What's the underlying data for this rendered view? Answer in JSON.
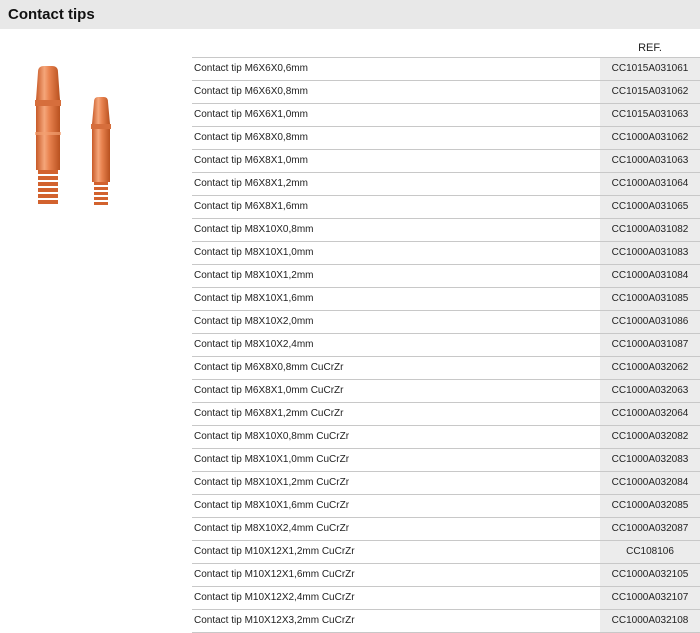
{
  "header": {
    "title": "Contact tips"
  },
  "table": {
    "ref_header": "REF.",
    "rows": [
      {
        "description": "Contact tip M6X6X0,6mm",
        "ref": "CC1015A031061"
      },
      {
        "description": "Contact tip M6X6X0,8mm",
        "ref": "CC1015A031062"
      },
      {
        "description": "Contact tip M6X6X1,0mm",
        "ref": "CC1015A031063"
      },
      {
        "description": "Contact tip M6X8X0,8mm",
        "ref": "CC1000A031062"
      },
      {
        "description": "Contact tip M6X8X1,0mm",
        "ref": "CC1000A031063"
      },
      {
        "description": "Contact tip M6X8X1,2mm",
        "ref": "CC1000A031064"
      },
      {
        "description": "Contact tip M6X8X1,6mm",
        "ref": "CC1000A031065"
      },
      {
        "description": "Contact tip M8X10X0,8mm",
        "ref": "CC1000A031082"
      },
      {
        "description": "Contact tip M8X10X1,0mm",
        "ref": "CC1000A031083"
      },
      {
        "description": "Contact tip M8X10X1,2mm",
        "ref": "CC1000A031084"
      },
      {
        "description": "Contact tip M8X10X1,6mm",
        "ref": "CC1000A031085"
      },
      {
        "description": "Contact tip M8X10X2,0mm",
        "ref": "CC1000A031086"
      },
      {
        "description": "Contact tip M8X10X2,4mm",
        "ref": "CC1000A031087"
      },
      {
        "description": "Contact tip M6X8X0,8mm CuCrZr",
        "ref": "CC1000A032062"
      },
      {
        "description": "Contact tip M6X8X1,0mm CuCrZr",
        "ref": "CC1000A032063"
      },
      {
        "description": "Contact tip M6X8X1,2mm CuCrZr",
        "ref": "CC1000A032064"
      },
      {
        "description": "Contact tip M8X10X0,8mm CuCrZr",
        "ref": "CC1000A032082"
      },
      {
        "description": "Contact tip M8X10X1,0mm CuCrZr",
        "ref": "CC1000A032083"
      },
      {
        "description": "Contact tip M8X10X1,2mm CuCrZr",
        "ref": "CC1000A032084"
      },
      {
        "description": "Contact tip M8X10X1,6mm CuCrZr",
        "ref": "CC1000A032085"
      },
      {
        "description": "Contact tip M8X10X2,4mm CuCrZr",
        "ref": "CC1000A032087"
      },
      {
        "description": "Contact tip M10X12X1,2mm CuCrZr",
        "ref": "CC108106"
      },
      {
        "description": "Contact tip M10X12X1,6mm CuCrZr",
        "ref": "CC1000A032105"
      },
      {
        "description": "Contact tip M10X12X2,4mm CuCrZr",
        "ref": "CC1000A032107"
      },
      {
        "description": "Contact tip M10X12X3,2mm CuCrZr",
        "ref": "CC1000A032108"
      }
    ]
  },
  "image": {
    "icon": "copper-contact-tips-image",
    "color": "#e07a45"
  }
}
